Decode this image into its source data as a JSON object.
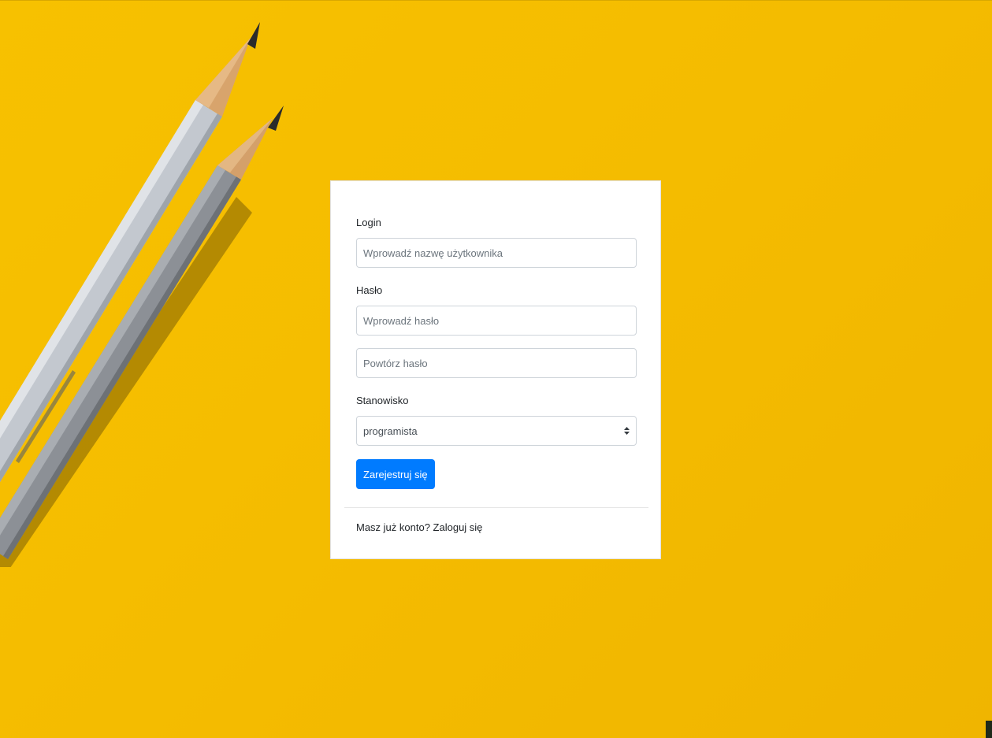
{
  "form": {
    "login_label": "Login",
    "login_placeholder": "Wprowadź nazwę użytkownika",
    "password_label": "Hasło",
    "password_placeholder": "Wprowadź hasło",
    "repeat_password_placeholder": "Powtórz hasło",
    "position_label": "Stanowisko",
    "position_selected": "programista",
    "submit_label": "Zarejestruj się",
    "login_link": "Masz już konto? Zaloguj się"
  },
  "colors": {
    "background": "#f5bd00",
    "primary_button": "#007bff",
    "card": "#ffffff"
  },
  "icons": {
    "select": "chevron-up-down-icon",
    "background": "pencils-illustration"
  }
}
